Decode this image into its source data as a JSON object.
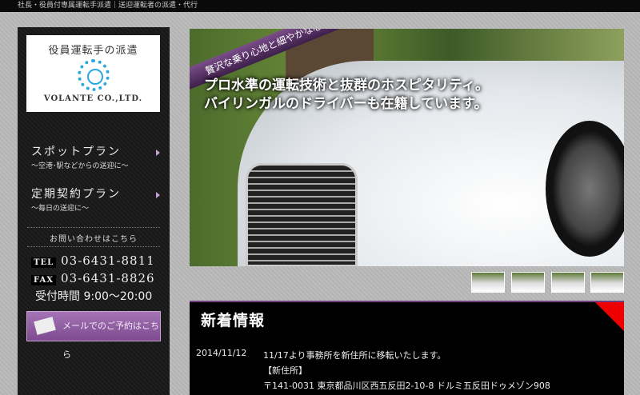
{
  "topbar": {
    "text": "社長・役員付専属運転手派遣｜送迎運転者の派遣・代行"
  },
  "logo": {
    "tagline": "役員運転手の派遣",
    "name": "VOLANTE CO.,LTD."
  },
  "plans": [
    {
      "title": "スポットプラン",
      "sub": "〜空港･駅などからの送迎に〜"
    },
    {
      "title": "定期契約プラン",
      "sub": "〜毎日の送迎に〜"
    }
  ],
  "contact": {
    "heading": "お問い合わせはこちら",
    "tel_label": "TEL",
    "tel": "03-6431-8811",
    "fax_label": "FAX",
    "fax": "03-6431-8826",
    "hours": "受付時間 9:00〜20:00",
    "mail_button": "メールでのご予約はこちら"
  },
  "hero": {
    "ribbon": "贅沢な乗り心地と細やかな心遣いを",
    "line1": "プロ水準の運転技術と抜群のホスピタリティ。",
    "line2": "バイリンガルのドライバーも在籍しています。"
  },
  "news": {
    "title": "新着情報",
    "items": [
      {
        "date": "2014/11/12",
        "lines": [
          "11/17より事務所を新住所に移転いたします。",
          "【新住所】",
          "〒141-0031 東京都品川区西五反田2-10-8 ドルミ五反田ドゥメゾン908"
        ]
      }
    ]
  },
  "colors": {
    "accent": "#7d4a8f",
    "corner": "#e00000"
  }
}
